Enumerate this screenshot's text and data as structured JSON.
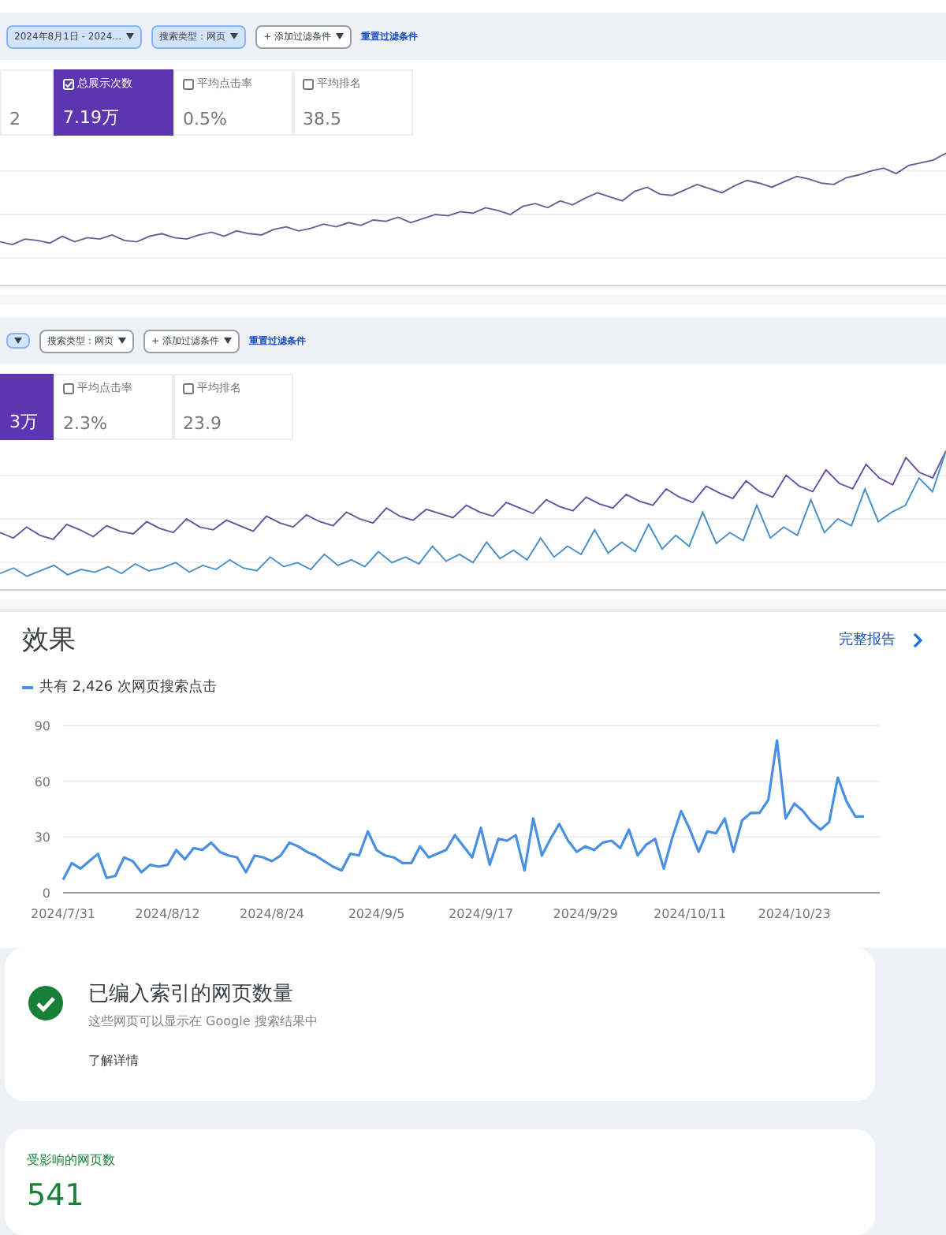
{
  "panels": [
    {
      "chips": [
        {
          "text": "2024年8月1日 - 2024…",
          "active": true
        },
        {
          "text": "搜索类型：网页",
          "active": true
        },
        {
          "text": "+ 添加过滤条件",
          "active": false
        }
      ],
      "reset_link": "重置过滤条件",
      "metrics": [
        {
          "value": "2",
          "selected": false
        },
        {
          "label": "总展示次数",
          "value": "7.19万",
          "selected": true
        },
        {
          "label": "平均点击率",
          "value": "0.5%",
          "selected": false
        },
        {
          "label": "平均排名",
          "value": "38.5",
          "selected": false
        }
      ]
    },
    {
      "chips": [
        {
          "active": true
        },
        {
          "text": "搜索类型：网页",
          "active": false
        },
        {
          "text": "+ 添加过滤条件",
          "active": false
        }
      ],
      "reset_link": "重置过滤条件",
      "metrics": [
        {
          "value": "3万",
          "selected": true
        },
        {
          "label": "平均点击率",
          "value": "2.3%",
          "selected": false
        },
        {
          "label": "平均排名",
          "value": "23.9",
          "selected": false
        }
      ]
    }
  ],
  "performance": {
    "title": "效果",
    "full_report_link": "完整报告",
    "legend": "共有 2,426 次网页搜索点击",
    "chart_data": {
      "type": "line",
      "yticks": [
        0,
        30,
        60,
        90
      ],
      "ylim": [
        0,
        90
      ],
      "grid": true,
      "categories": [
        "2024/7/31",
        null,
        null,
        null,
        null,
        null,
        null,
        null,
        null,
        null,
        null,
        null,
        "2024/8/12",
        null,
        null,
        null,
        null,
        null,
        null,
        null,
        null,
        null,
        null,
        null,
        "2024/8/24",
        null,
        null,
        null,
        null,
        null,
        null,
        null,
        null,
        null,
        null,
        null,
        "2024/9/5",
        null,
        null,
        null,
        null,
        null,
        null,
        null,
        null,
        null,
        null,
        null,
        "2024/9/17",
        null,
        null,
        null,
        null,
        null,
        null,
        null,
        null,
        null,
        null,
        null,
        "2024/9/29",
        null,
        null,
        null,
        null,
        null,
        null,
        null,
        null,
        null,
        null,
        null,
        "2024/10/11",
        null,
        null,
        null,
        null,
        null,
        null,
        null,
        null,
        null,
        null,
        null,
        "2024/10/23",
        null,
        null,
        null,
        null,
        null,
        null,
        null,
        null
      ],
      "series": [
        {
          "color": "#4a90e2",
          "values": [
            7,
            16,
            13,
            17,
            21,
            8,
            9,
            19,
            17,
            11,
            15,
            14,
            15,
            23,
            18,
            24,
            23,
            27,
            22,
            20,
            19,
            11,
            20,
            19,
            17,
            20,
            27,
            25,
            22,
            20,
            17,
            14,
            12,
            21,
            20,
            33,
            23,
            20,
            19,
            16,
            16,
            25,
            19,
            21,
            23,
            31,
            25,
            19,
            35,
            15,
            29,
            28,
            31,
            12,
            40,
            20,
            29,
            37,
            28,
            22,
            25,
            23,
            27,
            28,
            24,
            34,
            20,
            26,
            29,
            13,
            30,
            44,
            34,
            22,
            33,
            32,
            40,
            22,
            39,
            43,
            43,
            50,
            82,
            40,
            48,
            44,
            38,
            34,
            38,
            62,
            49,
            41,
            41
          ]
        }
      ]
    }
  },
  "index_card": {
    "title": "已编入索引的网页数量",
    "subtitle": "这些网页可以显示在 Google 搜索结果中",
    "link": "了解详情"
  },
  "affected_card": {
    "label": "受影响的网页数",
    "value": "541"
  }
}
